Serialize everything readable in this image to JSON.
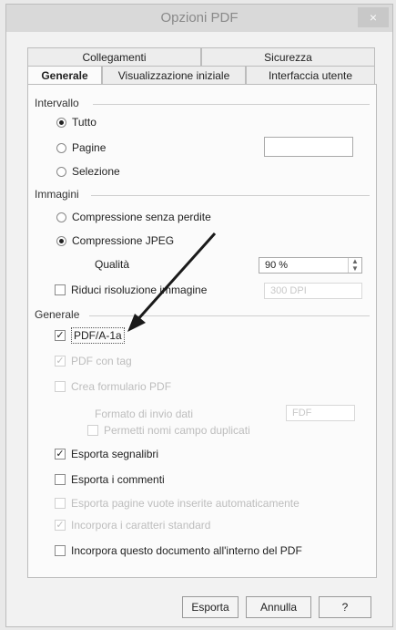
{
  "window": {
    "title": "Opzioni PDF",
    "close_glyph": "×"
  },
  "tabs": {
    "row1": [
      "Collegamenti",
      "Sicurezza"
    ],
    "row2": [
      "Generale",
      "Visualizzazione iniziale",
      "Interfaccia utente"
    ],
    "active": "Generale"
  },
  "intervallo": {
    "label": "Intervallo",
    "options": [
      {
        "label": "Tutto",
        "selected": true
      },
      {
        "label": "Pagine",
        "selected": false
      },
      {
        "label": "Selezione",
        "selected": false
      }
    ],
    "pages_value": ""
  },
  "immagini": {
    "label": "Immagini",
    "lossless_label": "Compressione senza perdite",
    "jpeg_label": "Compressione JPEG",
    "quality_label": "Qualità",
    "quality_value": "90 %",
    "reduce_label": "Riduci risoluzione immagine",
    "reduce_value": "300 DPI"
  },
  "generale": {
    "label": "Generale",
    "pdfa_label": "PDF/A-1a",
    "tagged_label": "PDF con tag",
    "form_label": "Crea formulario PDF",
    "format_label": "Formato di invio dati",
    "format_value": "FDF",
    "duplicate_label": "Permetti nomi campo duplicati",
    "bookmarks_label": "Esporta segnalibri",
    "comments_label": "Esporta i commenti",
    "blank_label": "Esporta pagine vuote inserite automaticamente",
    "fonts_label": "Incorpora i caratteri standard",
    "embed_label": "Incorpora questo documento all'interno del PDF"
  },
  "buttons": {
    "export": "Esporta",
    "cancel": "Annulla",
    "help": "?"
  },
  "colors": {
    "window_bg": "#f2f2f2",
    "titlebar": "#d9d9d9",
    "arrow": "#1a1a1a"
  }
}
